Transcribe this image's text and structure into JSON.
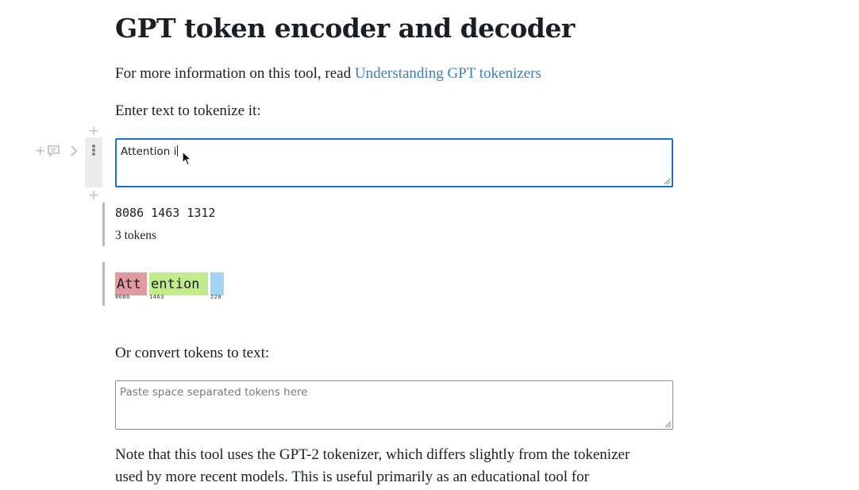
{
  "page": {
    "title": "GPT token encoder and decoder",
    "intro_prefix": "For more information on this tool, read ",
    "intro_link": "Understanding GPT tokenizers",
    "encode_prompt": "Enter text to tokenize it:",
    "decode_prompt": "Or convert tokens to text:",
    "note_line1": "Note that this tool uses the GPT-2 tokenizer, which differs slightly from the tokenizer",
    "note_line2": "used by more recent models. This is useful primarily as an educational tool for"
  },
  "encoder": {
    "input_value": "Attention i",
    "token_ids_text": "8086 1463 1312",
    "token_count_text": "3 tokens"
  },
  "tokens": [
    {
      "text": "Att",
      "id": "8086",
      "color": "#e09aa0"
    },
    {
      "text": "ention",
      "id": "1463",
      "color": "#c2eb8c"
    },
    {
      "text": " ",
      "id": "220",
      "color": "#a2d4f3"
    }
  ],
  "decoder": {
    "placeholder": "Paste space separated tokens here",
    "value": ""
  },
  "icons": {
    "add_cell_above": "plus-icon",
    "add_cell_below": "plus-icon",
    "cell_menu": "vertical-ellipsis-icon",
    "comment": "comment-icon",
    "expand": "chevron-right-icon",
    "cursor": "mouse-pointer-icon"
  },
  "colors": {
    "link": "#3b7fbf",
    "focus_border": "#1f6ed4",
    "output_bar": "#b6b9c1"
  }
}
